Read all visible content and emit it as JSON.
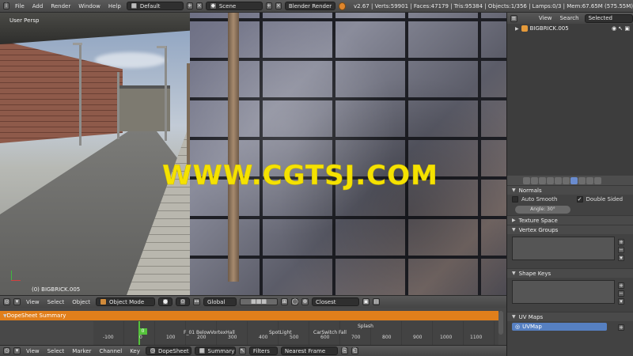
{
  "topbar": {
    "menus": [
      "File",
      "Add",
      "Render",
      "Window",
      "Help"
    ],
    "layout": "Default",
    "scene": "Scene",
    "engine": "Blender Render",
    "stats": "v2.67 | Verts:59901 | Faces:47179 | Tris:95384 | Objects:1/356 | Lamps:0/3 | Mem:67.65M (575.55M)"
  },
  "viewport": {
    "view_name": "User Persp",
    "object_label": "(0) BIGBRICK.005",
    "watermark": "WWW.CGTSJ.COM"
  },
  "viewport_header": {
    "menus": [
      "View",
      "Select",
      "Object"
    ],
    "mode": "Object Mode",
    "orientation": "Global",
    "snap": "Closest"
  },
  "dopesheet": {
    "summary": "DopeSheet Summary",
    "current_frame": "0",
    "markers": [
      "F_01",
      "Below",
      "VortexHall",
      "SpotLight",
      "CarSwitch",
      "Fall",
      "Splash"
    ],
    "ruler": [
      "-100",
      "0",
      "100",
      "200",
      "300",
      "400",
      "500",
      "600",
      "700",
      "800",
      "900",
      "1000",
      "1100"
    ]
  },
  "dopesheet_header": {
    "menus": [
      "View",
      "Select",
      "Marker",
      "Channel",
      "Key"
    ],
    "mode": "DopeSheet",
    "context": "Summary",
    "filters": "Filters",
    "snap": "Nearest Frame"
  },
  "outliner": {
    "menus": [
      "View",
      "Search"
    ],
    "display": "Selected",
    "item": "BIGBRICK.005"
  },
  "properties": {
    "normals": "Normals",
    "auto_smooth": "Auto Smooth",
    "double_sided": "Double Sided",
    "angle": "Angle: 30°",
    "texture_space": "Texture Space",
    "vertex_groups": "Vertex Groups",
    "shape_keys": "Shape Keys",
    "uv_maps": "UV Maps",
    "uv_item": "UVMap"
  },
  "colors": {
    "accent": "#e17f1b",
    "selection": "#5680c2",
    "watermark": "#f5e200",
    "frame": "#55c23b"
  }
}
